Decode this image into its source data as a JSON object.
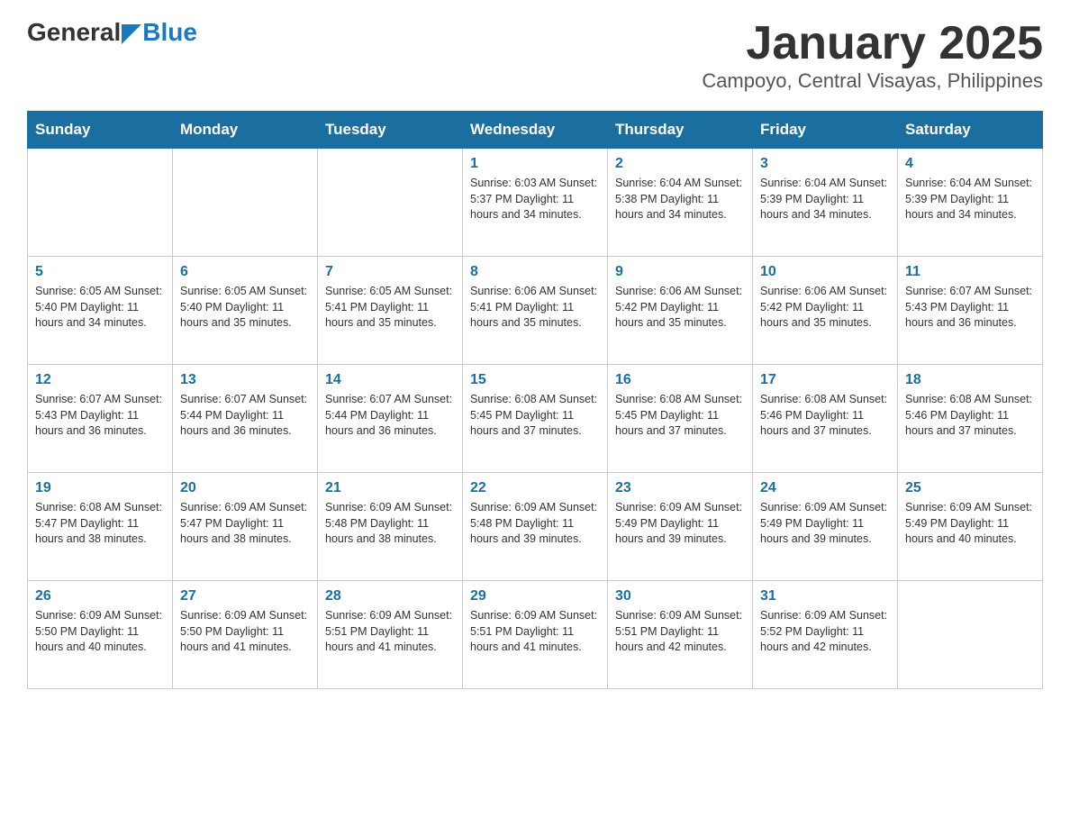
{
  "header": {
    "logo": {
      "general": "General",
      "blue": "Blue"
    },
    "title": "January 2025",
    "subtitle": "Campoyo, Central Visayas, Philippines"
  },
  "weekdays": [
    "Sunday",
    "Monday",
    "Tuesday",
    "Wednesday",
    "Thursday",
    "Friday",
    "Saturday"
  ],
  "weeks": [
    [
      {
        "day": "",
        "info": ""
      },
      {
        "day": "",
        "info": ""
      },
      {
        "day": "",
        "info": ""
      },
      {
        "day": "1",
        "info": "Sunrise: 6:03 AM\nSunset: 5:37 PM\nDaylight: 11 hours and 34 minutes."
      },
      {
        "day": "2",
        "info": "Sunrise: 6:04 AM\nSunset: 5:38 PM\nDaylight: 11 hours and 34 minutes."
      },
      {
        "day": "3",
        "info": "Sunrise: 6:04 AM\nSunset: 5:39 PM\nDaylight: 11 hours and 34 minutes."
      },
      {
        "day": "4",
        "info": "Sunrise: 6:04 AM\nSunset: 5:39 PM\nDaylight: 11 hours and 34 minutes."
      }
    ],
    [
      {
        "day": "5",
        "info": "Sunrise: 6:05 AM\nSunset: 5:40 PM\nDaylight: 11 hours and 34 minutes."
      },
      {
        "day": "6",
        "info": "Sunrise: 6:05 AM\nSunset: 5:40 PM\nDaylight: 11 hours and 35 minutes."
      },
      {
        "day": "7",
        "info": "Sunrise: 6:05 AM\nSunset: 5:41 PM\nDaylight: 11 hours and 35 minutes."
      },
      {
        "day": "8",
        "info": "Sunrise: 6:06 AM\nSunset: 5:41 PM\nDaylight: 11 hours and 35 minutes."
      },
      {
        "day": "9",
        "info": "Sunrise: 6:06 AM\nSunset: 5:42 PM\nDaylight: 11 hours and 35 minutes."
      },
      {
        "day": "10",
        "info": "Sunrise: 6:06 AM\nSunset: 5:42 PM\nDaylight: 11 hours and 35 minutes."
      },
      {
        "day": "11",
        "info": "Sunrise: 6:07 AM\nSunset: 5:43 PM\nDaylight: 11 hours and 36 minutes."
      }
    ],
    [
      {
        "day": "12",
        "info": "Sunrise: 6:07 AM\nSunset: 5:43 PM\nDaylight: 11 hours and 36 minutes."
      },
      {
        "day": "13",
        "info": "Sunrise: 6:07 AM\nSunset: 5:44 PM\nDaylight: 11 hours and 36 minutes."
      },
      {
        "day": "14",
        "info": "Sunrise: 6:07 AM\nSunset: 5:44 PM\nDaylight: 11 hours and 36 minutes."
      },
      {
        "day": "15",
        "info": "Sunrise: 6:08 AM\nSunset: 5:45 PM\nDaylight: 11 hours and 37 minutes."
      },
      {
        "day": "16",
        "info": "Sunrise: 6:08 AM\nSunset: 5:45 PM\nDaylight: 11 hours and 37 minutes."
      },
      {
        "day": "17",
        "info": "Sunrise: 6:08 AM\nSunset: 5:46 PM\nDaylight: 11 hours and 37 minutes."
      },
      {
        "day": "18",
        "info": "Sunrise: 6:08 AM\nSunset: 5:46 PM\nDaylight: 11 hours and 37 minutes."
      }
    ],
    [
      {
        "day": "19",
        "info": "Sunrise: 6:08 AM\nSunset: 5:47 PM\nDaylight: 11 hours and 38 minutes."
      },
      {
        "day": "20",
        "info": "Sunrise: 6:09 AM\nSunset: 5:47 PM\nDaylight: 11 hours and 38 minutes."
      },
      {
        "day": "21",
        "info": "Sunrise: 6:09 AM\nSunset: 5:48 PM\nDaylight: 11 hours and 38 minutes."
      },
      {
        "day": "22",
        "info": "Sunrise: 6:09 AM\nSunset: 5:48 PM\nDaylight: 11 hours and 39 minutes."
      },
      {
        "day": "23",
        "info": "Sunrise: 6:09 AM\nSunset: 5:49 PM\nDaylight: 11 hours and 39 minutes."
      },
      {
        "day": "24",
        "info": "Sunrise: 6:09 AM\nSunset: 5:49 PM\nDaylight: 11 hours and 39 minutes."
      },
      {
        "day": "25",
        "info": "Sunrise: 6:09 AM\nSunset: 5:49 PM\nDaylight: 11 hours and 40 minutes."
      }
    ],
    [
      {
        "day": "26",
        "info": "Sunrise: 6:09 AM\nSunset: 5:50 PM\nDaylight: 11 hours and 40 minutes."
      },
      {
        "day": "27",
        "info": "Sunrise: 6:09 AM\nSunset: 5:50 PM\nDaylight: 11 hours and 41 minutes."
      },
      {
        "day": "28",
        "info": "Sunrise: 6:09 AM\nSunset: 5:51 PM\nDaylight: 11 hours and 41 minutes."
      },
      {
        "day": "29",
        "info": "Sunrise: 6:09 AM\nSunset: 5:51 PM\nDaylight: 11 hours and 41 minutes."
      },
      {
        "day": "30",
        "info": "Sunrise: 6:09 AM\nSunset: 5:51 PM\nDaylight: 11 hours and 42 minutes."
      },
      {
        "day": "31",
        "info": "Sunrise: 6:09 AM\nSunset: 5:52 PM\nDaylight: 11 hours and 42 minutes."
      },
      {
        "day": "",
        "info": ""
      }
    ]
  ]
}
